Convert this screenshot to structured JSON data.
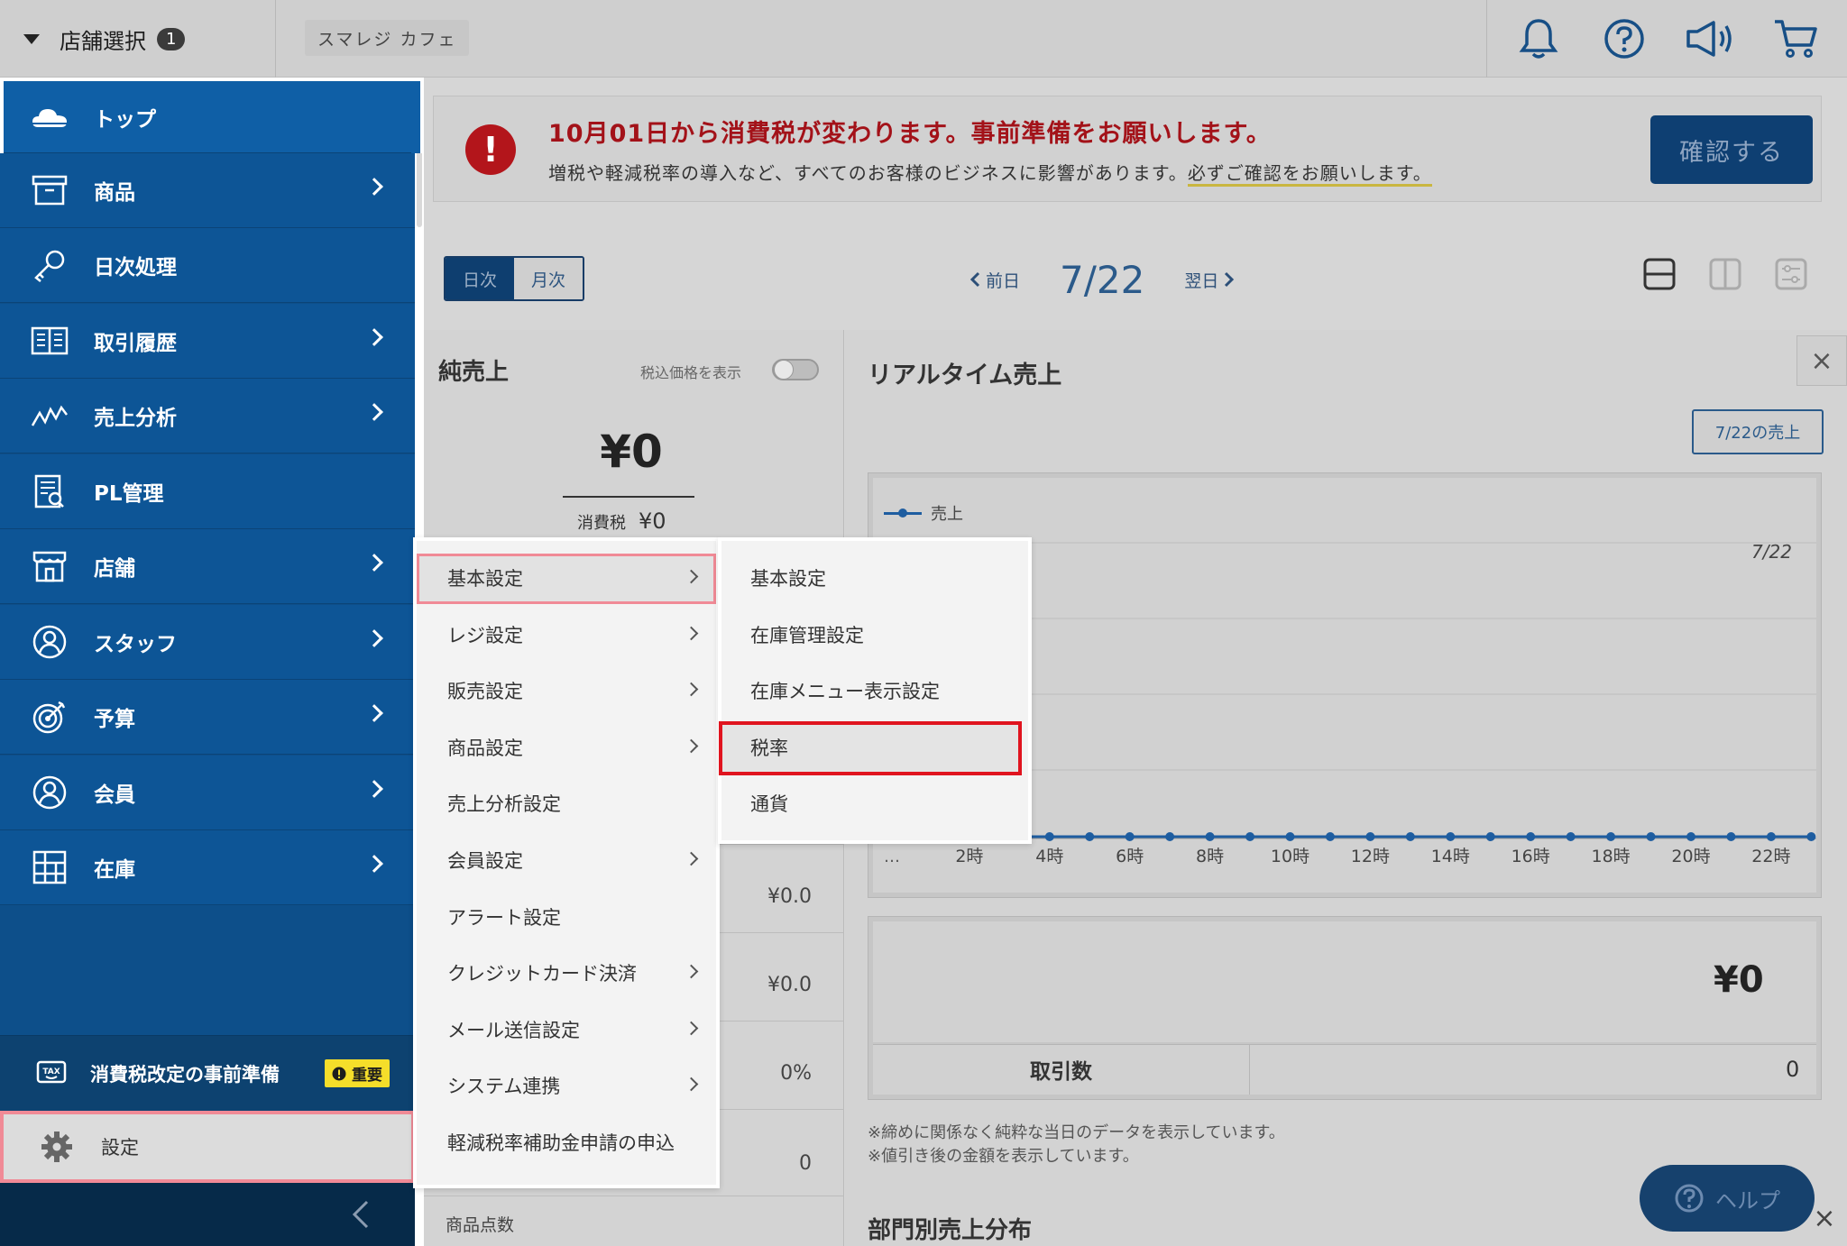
{
  "topbar": {
    "store_select_label": "店舗選択",
    "store_count": "1",
    "store_name": "スマレジ カフェ",
    "icons": [
      "bell-icon",
      "help-circle-icon",
      "megaphone-icon",
      "cart-icon"
    ]
  },
  "sidebar": {
    "items": [
      {
        "label": "トップ",
        "icon": "cloud-icon"
      },
      {
        "label": "商品",
        "icon": "box-icon"
      },
      {
        "label": "日次処理",
        "icon": "key-icon"
      },
      {
        "label": "取引履歴",
        "icon": "book-icon"
      },
      {
        "label": "売上分析",
        "icon": "trend-icon"
      },
      {
        "label": "PL管理",
        "icon": "report-icon"
      },
      {
        "label": "店舗",
        "icon": "store-icon"
      },
      {
        "label": "スタッフ",
        "icon": "staff-icon"
      },
      {
        "label": "予算",
        "icon": "target-icon"
      },
      {
        "label": "会員",
        "icon": "member-icon"
      },
      {
        "label": "在庫",
        "icon": "grid-icon"
      }
    ],
    "tax_prep_label": "消費税改定の事前準備",
    "important_badge": "重要",
    "settings_label": "設定"
  },
  "notice": {
    "title": "10月01日から消費税が変わります。事前準備をお願いします。",
    "body_prefix": "増税や軽減税率の導入など、すべてのお客様のビジネスに影響があります。",
    "body_highlight": "必ずご確認をお願いします。",
    "icon_text": "!",
    "confirm_label": "確認する"
  },
  "toolbar": {
    "daily": "日次",
    "monthly": "月次",
    "prev_label": "前日",
    "date": "7/22",
    "next_label": "翌日"
  },
  "net_sales": {
    "title": "純売上",
    "tax_incl_label": "税込価格を表示",
    "amount": "¥0",
    "tax_label": "消費税",
    "tax_amount": "¥0",
    "rows": [
      "¥0.0",
      "¥0.0",
      "0%",
      "0"
    ],
    "product_count_label": "商品点数"
  },
  "realtime": {
    "title": "リアルタイム売上",
    "daily_button": "7/22の売上",
    "legend": "売上",
    "chart_date": "7/22",
    "ellipsis": "…",
    "summary_amount": "¥0",
    "txn_label": "取引数",
    "txn_value": "0",
    "note1": "※締めに関係なく純粋な当日のデータを表示しています。",
    "note2": "※値引き後の金額を表示しています。",
    "dept_title": "部門別売上分布",
    "help_label": "ヘルプ"
  },
  "chart_data": {
    "type": "line",
    "x": [
      "2時",
      "4時",
      "6時",
      "8時",
      "10時",
      "12時",
      "14時",
      "16時",
      "18時",
      "20時",
      "22時"
    ],
    "series": [
      {
        "name": "売上",
        "values": [
          0,
          0,
          0,
          0,
          0,
          0,
          0,
          0,
          0,
          0,
          0
        ]
      }
    ],
    "xlabel": "",
    "ylabel": "",
    "color": "#1e5da0"
  },
  "menu1": {
    "items": [
      {
        "label": "基本設定",
        "has_submenu": true
      },
      {
        "label": "レジ設定",
        "has_submenu": true
      },
      {
        "label": "販売設定",
        "has_submenu": true
      },
      {
        "label": "商品設定",
        "has_submenu": true
      },
      {
        "label": "売上分析設定",
        "has_submenu": false
      },
      {
        "label": "会員設定",
        "has_submenu": true
      },
      {
        "label": "アラート設定",
        "has_submenu": false
      },
      {
        "label": "クレジットカード決済",
        "has_submenu": true
      },
      {
        "label": "メール送信設定",
        "has_submenu": true
      },
      {
        "label": "システム連携",
        "has_submenu": true
      },
      {
        "label": "軽減税率補助金申請の申込",
        "has_submenu": false
      }
    ]
  },
  "menu2": {
    "items": [
      "基本設定",
      "在庫管理設定",
      "在庫メニュー表示設定",
      "税率",
      "通貨"
    ]
  }
}
